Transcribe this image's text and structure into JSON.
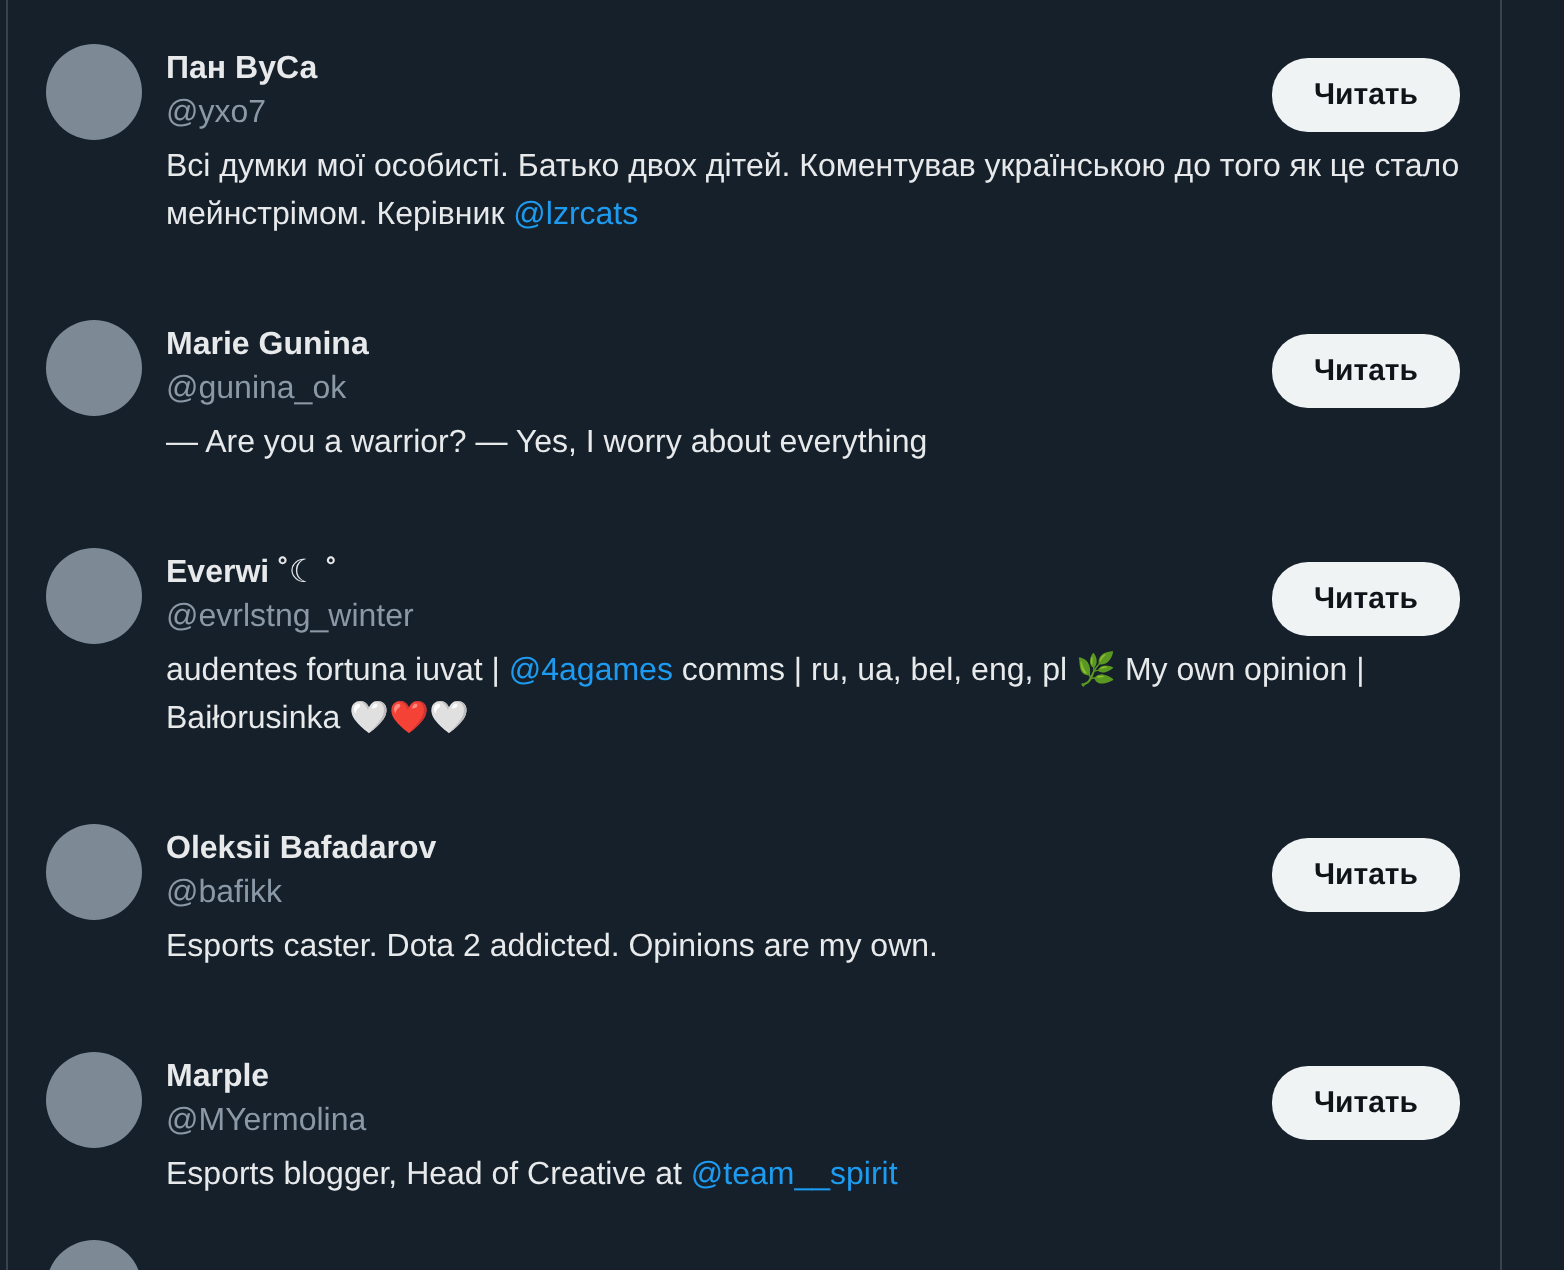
{
  "users": [
    {
      "name": "Пан ВуСа",
      "handle": "@yxo7",
      "button": "Читать",
      "bio": [
        {
          "kind": "text",
          "text": "Всі думки мої особисті. Батько двох дітей. Коментував українською до того як це стало мейнстрімом. Керівник "
        },
        {
          "kind": "link",
          "text": "@lzrcats"
        }
      ]
    },
    {
      "name": "Marie Gunina",
      "handle": "@gunina_ok",
      "button": "Читать",
      "bio": [
        {
          "kind": "text",
          "text": "— Are you a warrior? — Yes, I worry about everything"
        }
      ]
    },
    {
      "name": "Everwi ˚☾ ˚",
      "handle": "@evrlstng_winter",
      "button": "Читать",
      "bio": [
        {
          "kind": "text",
          "text": "audentes fortuna iuvat | "
        },
        {
          "kind": "link",
          "text": "@4agames"
        },
        {
          "kind": "text",
          "text": " comms | ru, ua, bel, eng, pl 🌿 My own opinion | Baiłorusinka 🤍❤️🤍"
        }
      ]
    },
    {
      "name": "Oleksii Bafadarov",
      "handle": "@bafikk",
      "button": "Читать",
      "bio": [
        {
          "kind": "text",
          "text": "Esports caster. Dota 2 addicted. Opinions are my own."
        }
      ]
    },
    {
      "name": "Marple",
      "handle": "@MYermolina",
      "button": "Читать",
      "bio": [
        {
          "kind": "text",
          "text": "Esports blogger, Head of Creative at "
        },
        {
          "kind": "link",
          "text": "@team__spirit"
        }
      ]
    }
  ]
}
